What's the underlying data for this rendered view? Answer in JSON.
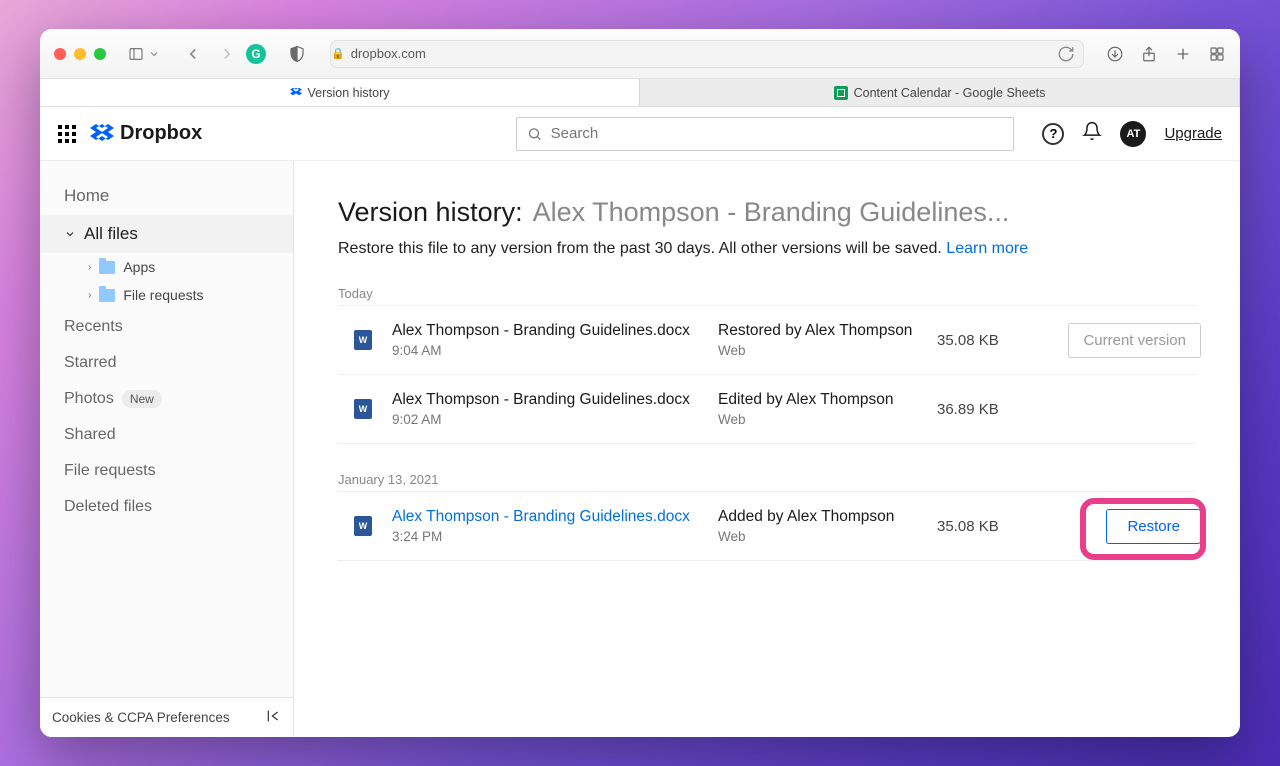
{
  "safari": {
    "url_display": "dropbox.com",
    "tabs": [
      {
        "label": "Version history",
        "active": true,
        "icon": "dropbox"
      },
      {
        "label": "Content Calendar - Google Sheets",
        "active": false,
        "icon": "sheets"
      }
    ]
  },
  "header": {
    "brand": "Dropbox",
    "search_placeholder": "Search",
    "avatar_initials": "AT",
    "upgrade_label": "Upgrade"
  },
  "sidebar": {
    "home": "Home",
    "all_files": "All files",
    "subfolders": [
      {
        "label": "Apps"
      },
      {
        "label": "File requests"
      }
    ],
    "recents": "Recents",
    "starred": "Starred",
    "photos": "Photos",
    "photos_badge": "New",
    "shared": "Shared",
    "file_requests": "File requests",
    "deleted": "Deleted files",
    "cookies": "Cookies & CCPA Preferences"
  },
  "page": {
    "title_prefix": "Version history:",
    "title_file": "Alex Thompson - Branding Guidelines...",
    "subhead_text": "Restore this file to any version from the past 30 days. All other versions will be saved. ",
    "learn_more": "Learn more"
  },
  "groups": [
    {
      "label": "Today",
      "versions": [
        {
          "name": "Alex Thompson - Branding Guidelines.docx",
          "time": "9:04 AM",
          "action": "Restored by Alex Thompson",
          "source": "Web",
          "size": "35.08 KB",
          "button": "Current version",
          "button_kind": "current",
          "name_link": false
        },
        {
          "name": "Alex Thompson - Branding Guidelines.docx",
          "time": "9:02 AM",
          "action": "Edited by Alex Thompson",
          "source": "Web",
          "size": "36.89 KB",
          "button": "",
          "button_kind": "none",
          "name_link": false
        }
      ]
    },
    {
      "label": "January 13, 2021",
      "versions": [
        {
          "name": "Alex Thompson - Branding Guidelines.docx",
          "time": "3:24 PM",
          "action": "Added by Alex Thompson",
          "source": "Web",
          "size": "35.08 KB",
          "button": "Restore",
          "button_kind": "restore",
          "name_link": true,
          "highlight": true
        }
      ]
    }
  ]
}
